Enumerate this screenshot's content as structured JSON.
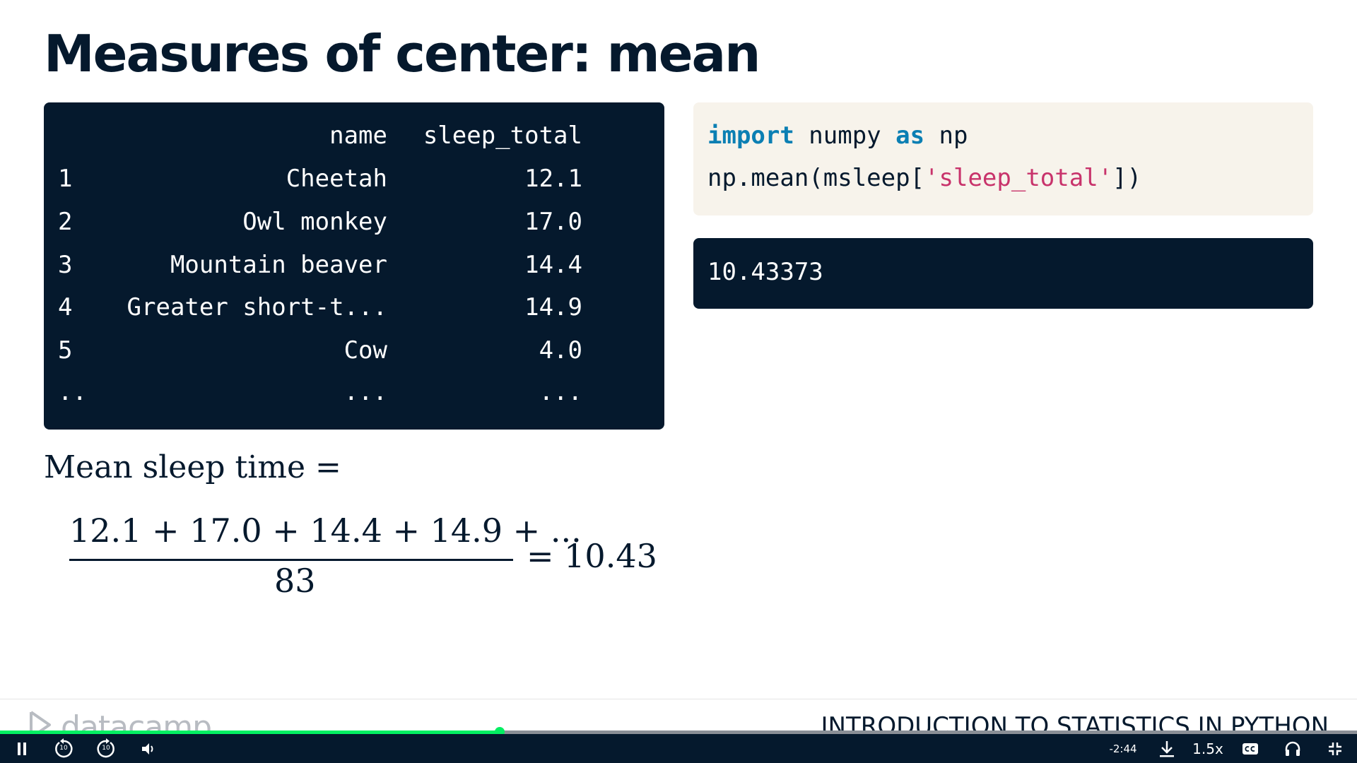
{
  "slide": {
    "title": "Measures of center: mean"
  },
  "dataframe": {
    "columns": [
      "name",
      "sleep_total"
    ],
    "rows": [
      {
        "index": "1",
        "name": "Cheetah",
        "sleep_total": "12.1"
      },
      {
        "index": "2",
        "name": "Owl monkey",
        "sleep_total": "17.0"
      },
      {
        "index": "3",
        "name": "Mountain beaver",
        "sleep_total": "14.4"
      },
      {
        "index": "4",
        "name": "Greater short-t...",
        "sleep_total": "14.9"
      },
      {
        "index": "5",
        "name": "Cow",
        "sleep_total": "4.0"
      },
      {
        "index": "..",
        "name": "...",
        "sleep_total": "..."
      }
    ]
  },
  "code": {
    "line1": {
      "kw1": "import",
      "mid": " numpy ",
      "kw2": "as",
      "end": " np"
    },
    "line2": {
      "pre": "np.mean(msleep[",
      "str": "'sleep_total'",
      "post": "])"
    }
  },
  "output": {
    "value": "10.43373"
  },
  "formula": {
    "label": "Mean sleep time =",
    "numerator": "12.1 + 17.0 + 14.4 + 14.9 + ...",
    "denominator": "83",
    "result": "= 10.43"
  },
  "footer": {
    "logo_text": "datacamp",
    "course_title": "INTRODUCTION TO STATISTICS IN PYTHON"
  },
  "player": {
    "progress_fraction": 0.368,
    "time_remaining": "-2:44",
    "speed": "1.5x",
    "rewind_seconds": "10",
    "forward_seconds": "10",
    "icons": [
      "pause-icon",
      "rewind-10-icon",
      "forward-10-icon",
      "volume-icon",
      "download-icon",
      "captions-icon",
      "headphones-icon",
      "exit-fullscreen-icon"
    ],
    "accent_color": "#03ef62",
    "bar_color": "#05192d"
  }
}
